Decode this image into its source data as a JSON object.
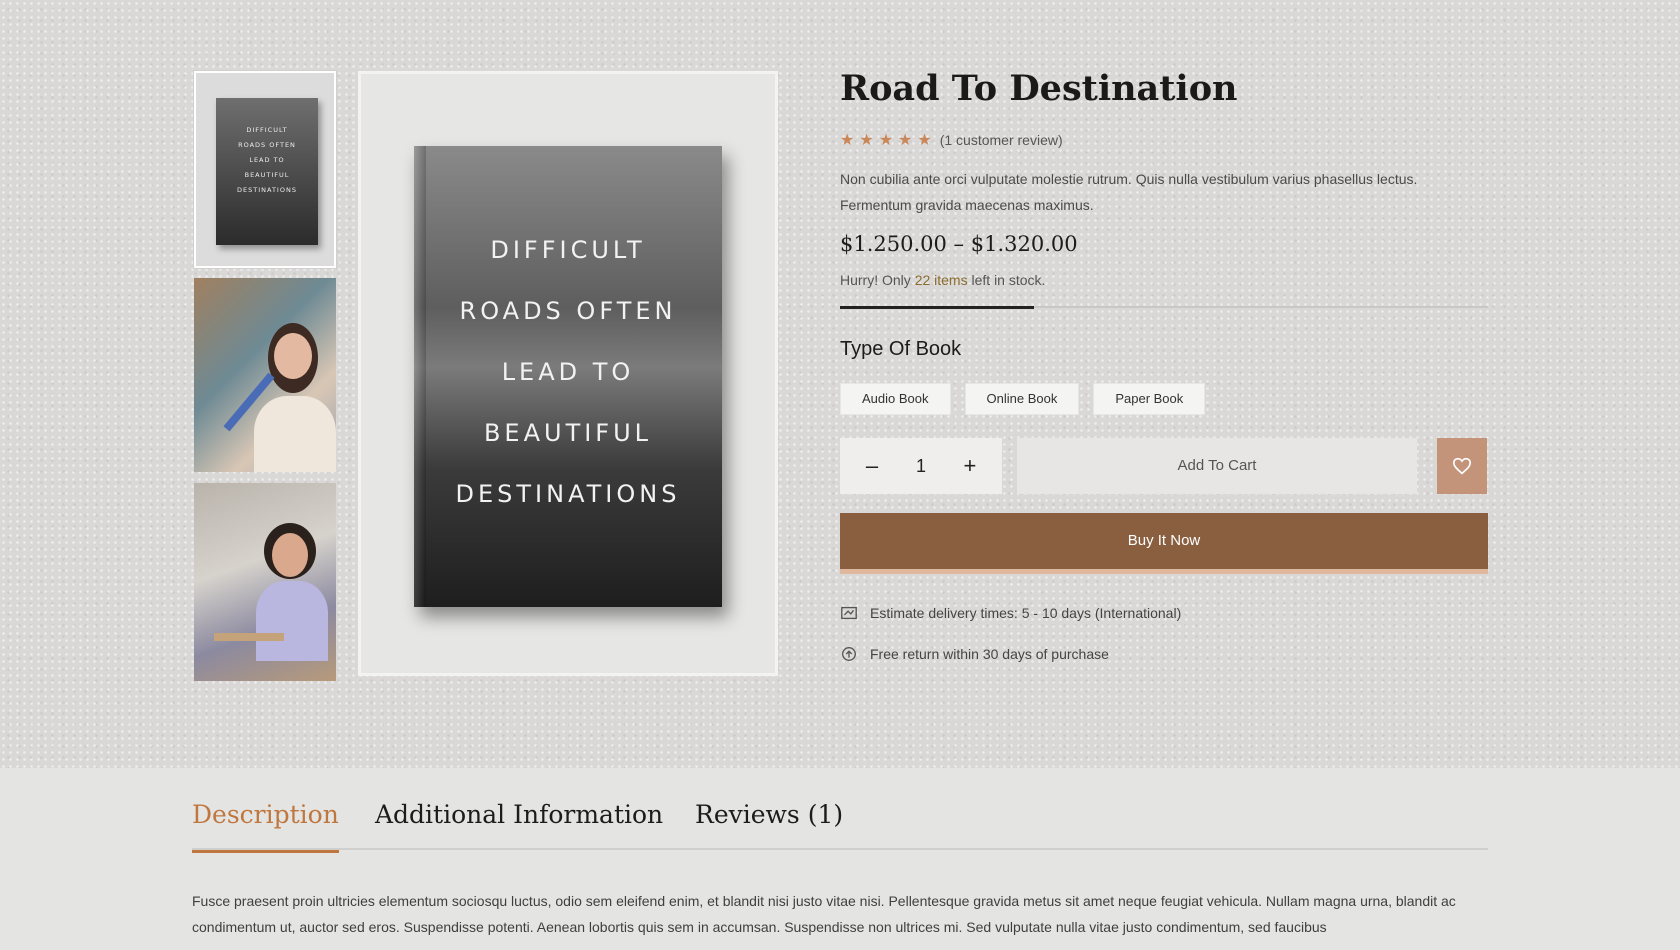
{
  "gallery": {
    "thumbnails": [
      {
        "kind": "book-cover",
        "lines": [
          "DIFFICULT",
          "ROADS OFTEN",
          "LEAD TO",
          "BEAUTIFUL",
          "DESTINATIONS"
        ]
      },
      {
        "kind": "woman-reading-photo"
      },
      {
        "kind": "woman-laptop-photo"
      }
    ],
    "main_cover_lines": [
      "DIFFICULT",
      "ROADS OFTEN",
      "LEAD TO",
      "BEAUTIFUL",
      "DESTINATIONS"
    ]
  },
  "product": {
    "title": "Road To Destination",
    "rating_stars": 5,
    "star_color": "#c9875a",
    "review_count_text": "(1 customer review)",
    "summary": "Non cubilia ante orci vulputate molestie rutrum. Quis nulla vestibulum varius phasellus lectus. Fermentum gravida maecenas maximus.",
    "price_range": "$1.250.00 – $1.320.00",
    "stock": {
      "prefix": "Hurry! Only",
      "qty": "22 items",
      "suffix": "left in stock.",
      "level": 0.3
    }
  },
  "variants": {
    "label": "Type Of Book",
    "options": [
      "Audio Book",
      "Online Book",
      "Paper Book"
    ]
  },
  "cart": {
    "minus": "–",
    "quantity": "1",
    "plus": "+",
    "add_to_cart": "Add To Cart",
    "wishlist_icon": "heart-icon",
    "buy_now": "Buy It Now",
    "accent_color": "#8a5f3f"
  },
  "info": {
    "delivery": "Estimate delivery times: 5 - 10 days (International)",
    "returns": "Free return within 30 days of purchase"
  },
  "tabs": [
    {
      "label": "Description",
      "active": true
    },
    {
      "label": "Additional Information",
      "active": false
    },
    {
      "label": "Reviews (1)",
      "active": false
    }
  ],
  "description_text": "Fusce praesent proin ultricies elementum sociosqu luctus, odio sem eleifend enim, et blandit nisi justo vitae nisi. Pellentesque gravida metus sit amet neque feugiat vehicula. Nullam magna urna, blandit ac condimentum ut, auctor sed eros. Suspendisse potenti. Aenean lobortis quis sem in accumsan. Suspendisse non ultrices mi. Sed vulputate nulla vitae justo condimentum, sed faucibus"
}
